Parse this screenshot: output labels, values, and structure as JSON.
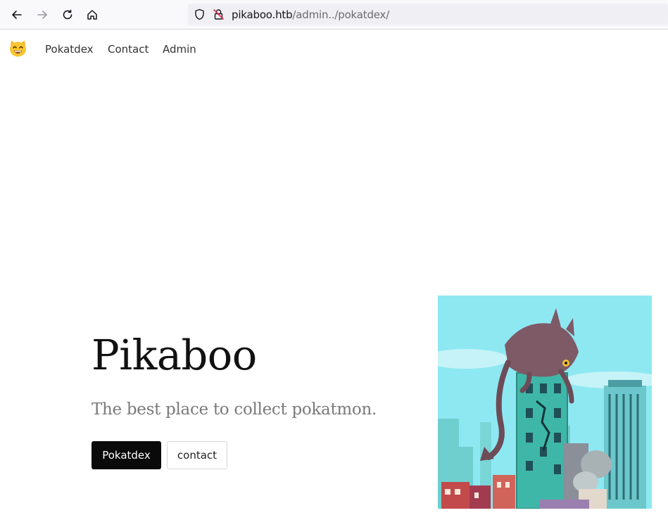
{
  "browser": {
    "url_host": "pikaboo.htb",
    "url_path": "/admin../pokatdex/"
  },
  "nav": {
    "logo_icon": "cat-smiling-emoji-icon",
    "links": [
      "Pokatdex",
      "Contact",
      "Admin"
    ]
  },
  "hero": {
    "title": "Pikaboo",
    "subtitle": "The best place to collect pokatmon.",
    "primary_button": "Pokatdex",
    "secondary_button": "contact",
    "image_icon": "monster-on-city-illustration"
  },
  "colors": {
    "primary_button_bg": "#0a0a0a",
    "subtitle_text": "#7a7a7a",
    "sky": "#8ee4ee"
  }
}
